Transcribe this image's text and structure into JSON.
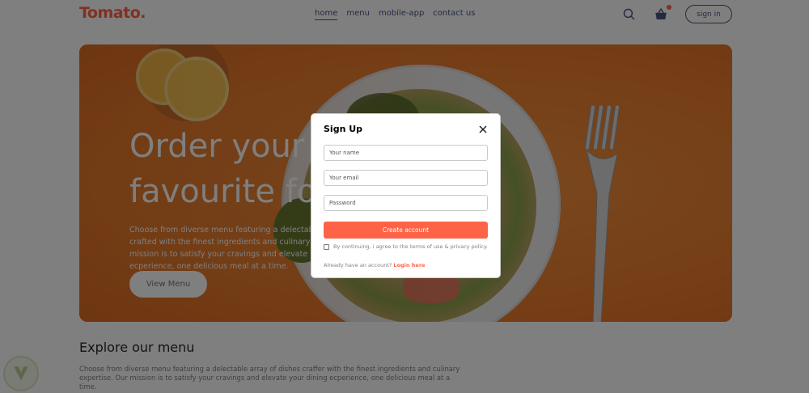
{
  "navbar": {
    "logo": "Tomato.",
    "menu": [
      "home",
      "menu",
      "mobile-app",
      "contact us"
    ],
    "active_menu": "home",
    "signin_label": "sign in"
  },
  "hero": {
    "title_line1": "Order your",
    "title_line2": "favourite fo",
    "description": "Choose from diverse menu featuring a delectable array of dishes crafted with the finest ingredients and culinary expertise. Our mission is to satisfy your cravings and elevate your dining ecperience, one delicious meal at a time.",
    "button_label": "View Menu"
  },
  "explore": {
    "title": "Explore our menu",
    "description": "Choose from diverse menu featuring a delectable array of dishes craffer with the finest ingredients and culinary expertise. Our mission is to satisfy your cravings and elevate your dining ecperience, one delicious meal at a time."
  },
  "modal": {
    "title": "Sign Up",
    "name_placeholder": "Your name",
    "email_placeholder": "Your email",
    "password_placeholder": "Password",
    "submit_label": "Create account",
    "terms_text": "By continuing, i agree to the terms of use & privacy policy.",
    "login_prompt": "Already have an account?",
    "login_link": "Login here"
  },
  "colors": {
    "brand": "#ff6347",
    "text": "#49557e",
    "hero_bg": "#f08030"
  },
  "icons": [
    "search-icon",
    "basket-icon",
    "close-icon"
  ]
}
